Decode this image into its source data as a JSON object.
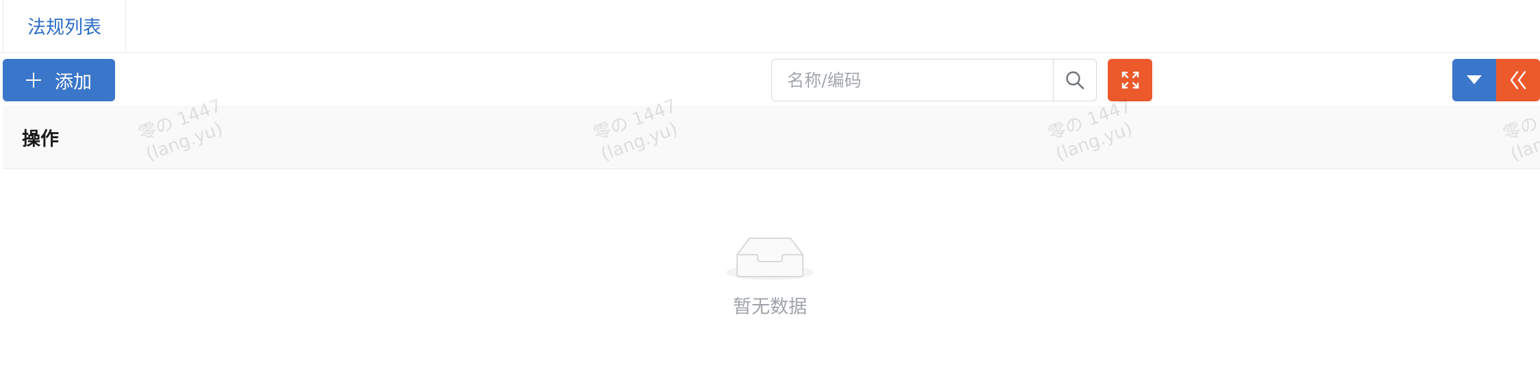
{
  "tabs": [
    {
      "label": "法规列表",
      "active": true
    }
  ],
  "toolbar": {
    "add_label": "添加",
    "search_placeholder": "名称/编码",
    "search_value": ""
  },
  "table": {
    "columns": [
      "操作"
    ],
    "rows": [],
    "empty_text": "暂无数据"
  },
  "watermark_text": "零の 1447\n(lang.yu)",
  "colors": {
    "primary": "#3a76c9",
    "accent": "#ec5a2c"
  },
  "icons": [
    "plus-icon",
    "search-icon",
    "fullscreen-icon",
    "caret-down-icon",
    "double-chevron-left-icon",
    "empty-inbox-icon"
  ]
}
